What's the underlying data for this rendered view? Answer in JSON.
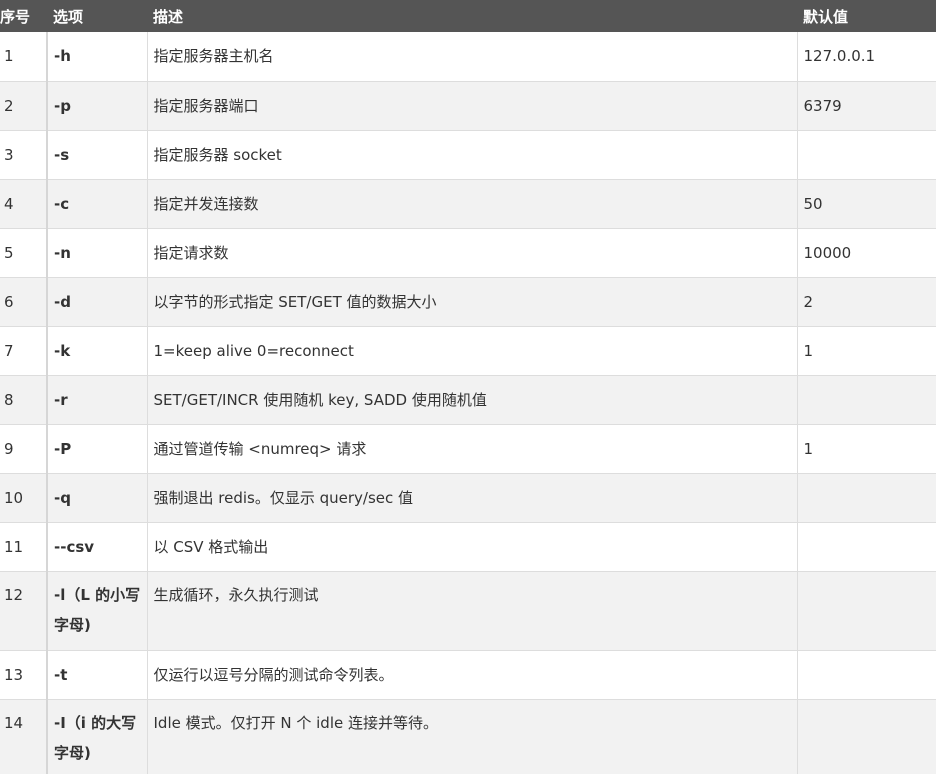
{
  "headers": [
    "序号",
    "选项",
    "描述",
    "默认值"
  ],
  "rows": [
    {
      "no": "1",
      "option": "-h",
      "desc": "指定服务器主机名",
      "default": "127.0.0.1"
    },
    {
      "no": "2",
      "option": "-p",
      "desc": "指定服务器端口",
      "default": "6379"
    },
    {
      "no": "3",
      "option": "-s",
      "desc": "指定服务器 socket",
      "default": ""
    },
    {
      "no": "4",
      "option": "-c",
      "desc": "指定并发连接数",
      "default": "50"
    },
    {
      "no": "5",
      "option": "-n",
      "desc": "指定请求数",
      "default": "10000"
    },
    {
      "no": "6",
      "option": "-d",
      "desc": "以字节的形式指定 SET/GET 值的数据大小",
      "default": "2"
    },
    {
      "no": "7",
      "option": "-k",
      "desc": "1=keep alive 0=reconnect",
      "default": "1"
    },
    {
      "no": "8",
      "option": "-r",
      "desc": "SET/GET/INCR 使用随机 key, SADD 使用随机值",
      "default": ""
    },
    {
      "no": "9",
      "option": "-P",
      "desc": "通过管道传输 <numreq> 请求",
      "default": "1"
    },
    {
      "no": "10",
      "option": "-q",
      "desc": "强制退出 redis。仅显示 query/sec 值",
      "default": ""
    },
    {
      "no": "11",
      "option": "--csv",
      "desc": "以 CSV 格式输出",
      "default": ""
    },
    {
      "no": "12",
      "option": "-l（L 的小写字母)",
      "desc": "生成循环，永久执行测试",
      "default": ""
    },
    {
      "no": "13",
      "option": "-t",
      "desc": "仅运行以逗号分隔的测试命令列表。",
      "default": ""
    },
    {
      "no": "14",
      "option": "-I（i 的大写字母)",
      "desc": "Idle 模式。仅打开 N 个 idle 连接并等待。",
      "default": ""
    }
  ]
}
